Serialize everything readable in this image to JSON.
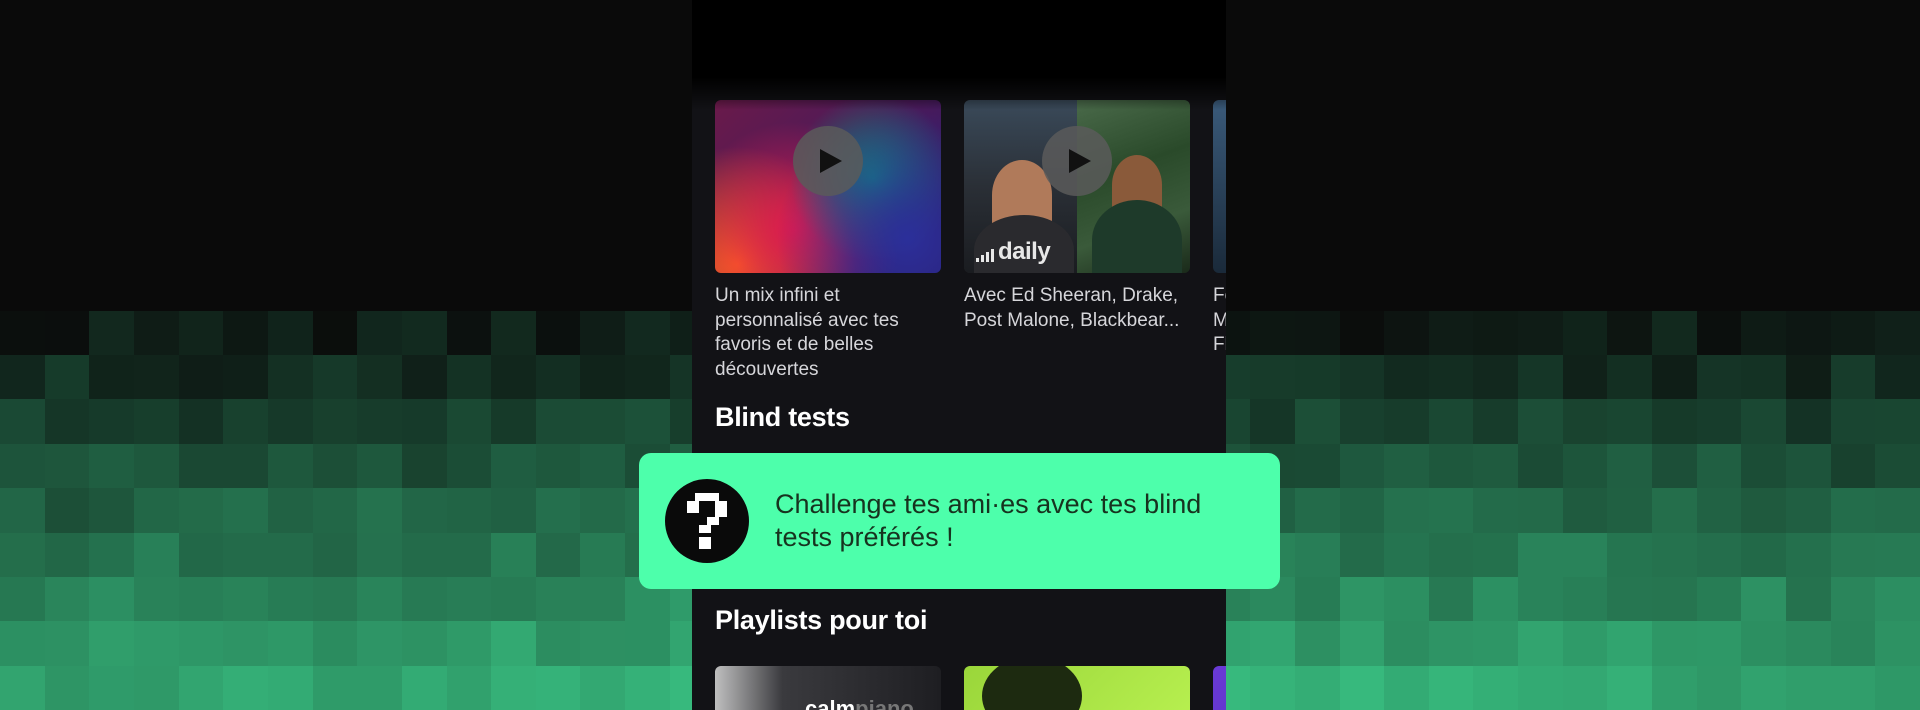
{
  "colors": {
    "accent_green": "#4dffab",
    "app_background": "#121216",
    "banner_text": "#17331f"
  },
  "flow_section": {
    "cards": [
      {
        "description": "Un mix infini et personnalisé avec tes favoris et de belles découvertes",
        "icon": "play-icon"
      },
      {
        "description": "Avec Ed Sheeran, Drake, Post Malone, Blackbear...",
        "cover_logo": "daily",
        "icon": "play-icon"
      },
      {
        "description": "Fe\nM\nFl"
      }
    ]
  },
  "blind_tests": {
    "title": "Blind tests",
    "banner_text": "Challenge tes ami·es avec tes blind tests préférés !",
    "icon": "question-mark-icon"
  },
  "playlists": {
    "title": "Playlists pour toi",
    "items": [
      {
        "cover_text_bold": "calm",
        "cover_text_muted": "piano"
      },
      {},
      {}
    ]
  }
}
